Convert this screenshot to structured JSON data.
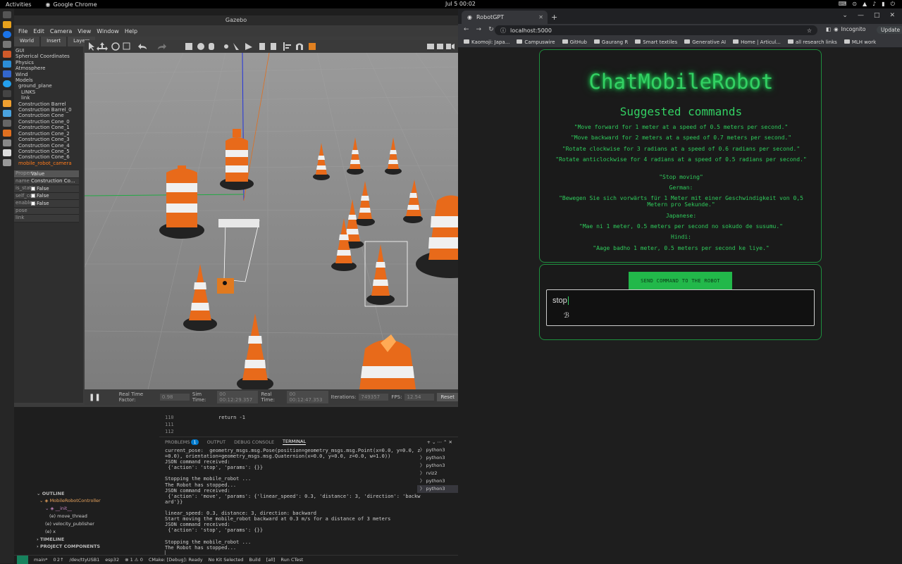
{
  "topbar": {
    "activities": "Activities",
    "app": "Google Chrome",
    "clock": "Jul 5  00:02"
  },
  "gazebo": {
    "title": "Gazebo",
    "menu": [
      "File",
      "Edit",
      "Camera",
      "View",
      "Window",
      "Help"
    ],
    "left_tabs": [
      "World",
      "Insert",
      "Layers"
    ],
    "tree": [
      "GUI",
      "Spherical Coordinates",
      "Physics",
      "Atmosphere",
      "Wind",
      "Models",
      "ground_plane",
      "LINKS",
      "link",
      "Construction Barrel",
      "Construction Barrel_0",
      "Construction Cone",
      "Construction Cone_0",
      "Construction Cone_1",
      "Construction Cone_2",
      "Construction Cone_3",
      "Construction Cone_4",
      "Construction Cone_5",
      "Construction Cone_6",
      "mobile_robot_camera"
    ],
    "prop_header": [
      "Property",
      "Value"
    ],
    "props": [
      {
        "k": "name",
        "v": "Construction Co..."
      },
      {
        "k": "is_static",
        "v": "False"
      },
      {
        "k": "self_coll...",
        "v": "False"
      },
      {
        "k": "enable_...",
        "v": "False"
      }
    ],
    "prop_extra": [
      "pose",
      "link"
    ],
    "status": {
      "rtf_label": "Real Time Factor:",
      "rtf": "0.98",
      "sim_label": "Sim Time:",
      "sim": "00 00:12:29.357",
      "real_label": "Real Time:",
      "real": "00 00:12:47.353",
      "iter_label": "Iterations:",
      "iter": "749357",
      "fps_label": "FPS:",
      "fps": "12.54",
      "reset": "Reset"
    }
  },
  "vscode": {
    "code_lines": [
      "110",
      "111",
      "112"
    ],
    "code_text": "return -1",
    "panel_tabs": {
      "problems": "PROBLEMS",
      "problems_count": "1",
      "output": "OUTPUT",
      "debug": "DEBUG CONSOLE",
      "terminal": "TERMINAL"
    },
    "terminal": [
      "current_pose:  geometry_msgs.msg.Pose(position=geometry_msgs.msg.Point(x=0.0, y=0.0, z",
      "=0.0), orientation=geometry_msgs.msg.Quaternion(x=0.0, y=0.0, z=0.0, w=1.0))",
      "JSON command received:",
      " {'action': 'stop', 'params': {}}",
      "",
      "Stopping the mobile_robot ...",
      "The Robot has stopped...",
      "JSON command received:",
      " {'action': 'move', 'params': {'linear_speed': 0.3, 'distance': 3, 'direction': 'backw",
      "ard'}}",
      "",
      "linear_speed: 0.3, distance: 3, direction: backward",
      "Start moving the mobile_robot backward at 0.3 m/s for a distance of 3 meters",
      "JSON command received:",
      " {'action': 'stop', 'params': {}}",
      "",
      "Stopping the mobile_robot ...",
      "The Robot has stopped...",
      "▏"
    ],
    "term_list": [
      "python3",
      "python3",
      "python3",
      "rviz2",
      "python3",
      "python3"
    ],
    "outline": {
      "header": "OUTLINE",
      "items": [
        "MobileRobotController",
        "__init__",
        "move_thread",
        "velocity_publisher",
        "x",
        "y"
      ],
      "timeline": "TIMELINE",
      "project": "PROJECT COMPONENTS"
    },
    "statusbar": [
      "main*",
      "0 2↑",
      "/dev/ttyUSB1",
      "esp32",
      "⊗ 1 ⚠ 0",
      "CMake: [Debug]: Ready",
      "No Kit Selected",
      "Build",
      "[all]",
      "Run CTest"
    ]
  },
  "chrome": {
    "tab_title": "RobotGPT",
    "url": "localhost:5000",
    "incognito": "Incognito",
    "update": "Update",
    "bookmarks": [
      "Kaomoji: Japa...",
      "Campuswire",
      "GitHub",
      "Gaurang R",
      "Smart textiles",
      "Generative AI",
      "Home | Articul...",
      "all research links",
      "MLH work"
    ]
  },
  "robotgpt": {
    "title": "ChatMobileRobot",
    "suggested_heading": "Suggested commands",
    "commands": [
      "\"Move forward for 1 meter at a speed of 0.5 meters per second.\"",
      "\"Move backward for 2 meters at a speed of 0.7 meters per second.\"",
      "\"Rotate clockwise for 3 radians at a speed of 0.6 radians per second.\"",
      "\"Rotate anticlockwise for 4 radians at a speed of 0.5 radians per second.\"",
      "\"Stop moving\"",
      "German:",
      "\"Bewegen Sie sich vorwärts für 1 Meter mit einer Geschwindigkeit von 0,5 Metern pro Sekunde.\"",
      "Japanese:",
      "\"Mae ni 1 meter, 0.5 meters per second no sokudo de susumu.\"",
      "Hindi:",
      "\"Aage badho 1 meter, 0.5 meters per second ke liye.\""
    ],
    "send_button": "SEND COMMAND TO THE ROBOT",
    "input_value": "stop"
  },
  "colors": {
    "accent_green": "#33d163",
    "button_green": "#22b84a",
    "vscode_blue": "#007acc"
  }
}
